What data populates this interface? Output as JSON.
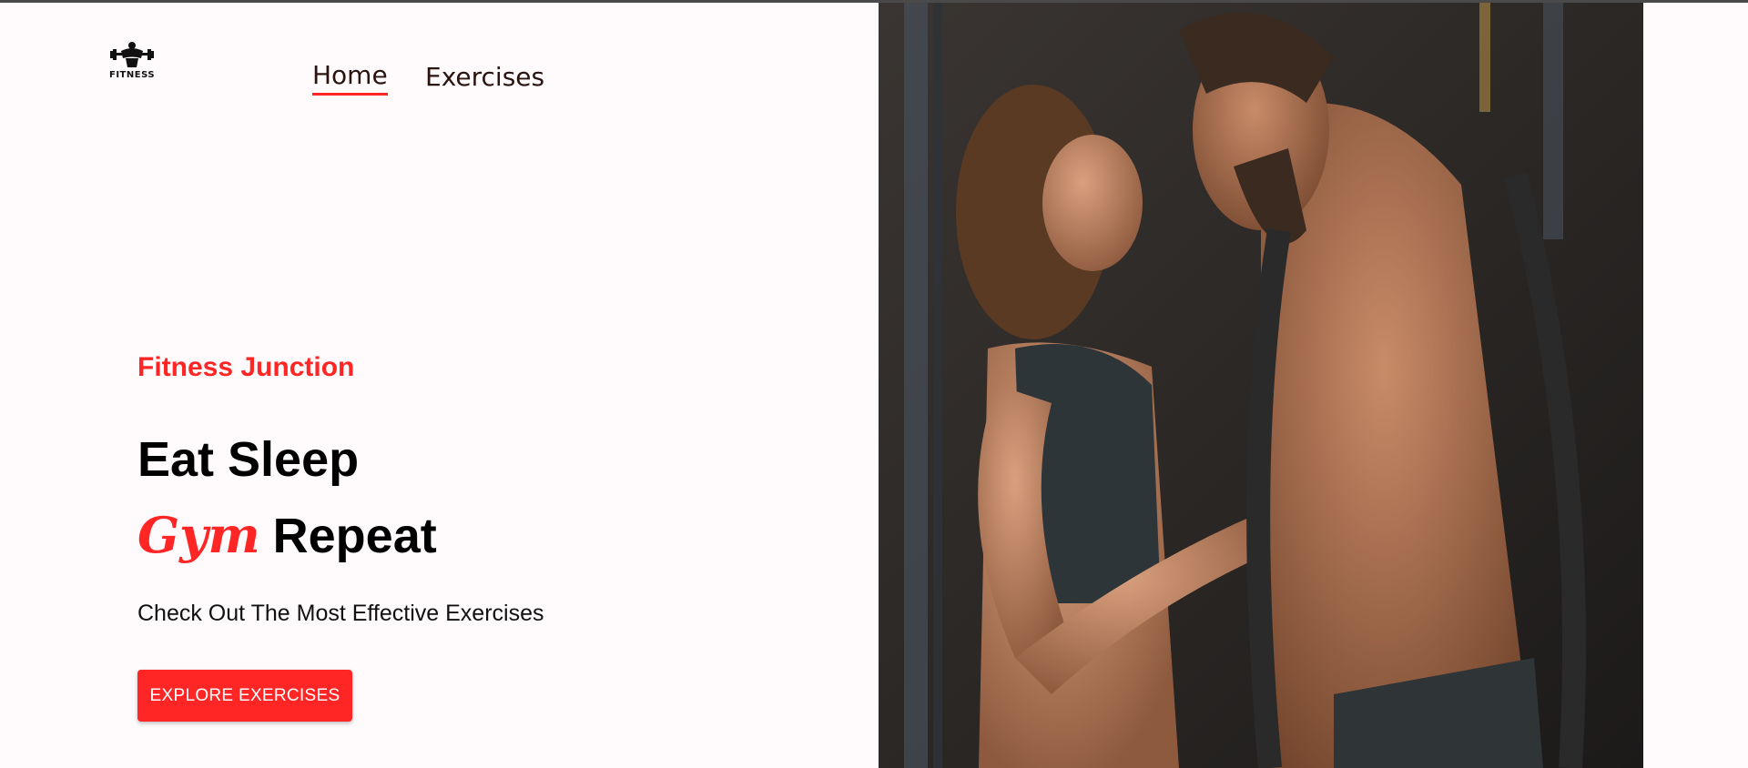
{
  "logo": {
    "icon": "bodybuilder-logo-icon",
    "text": "FITNESS"
  },
  "nav": {
    "items": [
      {
        "label": "Home",
        "active": true
      },
      {
        "label": "Exercises",
        "active": false
      }
    ]
  },
  "hero": {
    "brand": "Fitness Junction",
    "headline_line1": "Eat Sleep",
    "headline_accent": "Gym",
    "headline_rest": "Repeat",
    "subtitle": "Check Out The Most Effective Exercises",
    "cta_label": "EXPLORE EXERCISES",
    "image_icon": "banner-photo"
  },
  "colors": {
    "accent": "#ff2625",
    "background": "#fffafb",
    "text": "#000000"
  }
}
